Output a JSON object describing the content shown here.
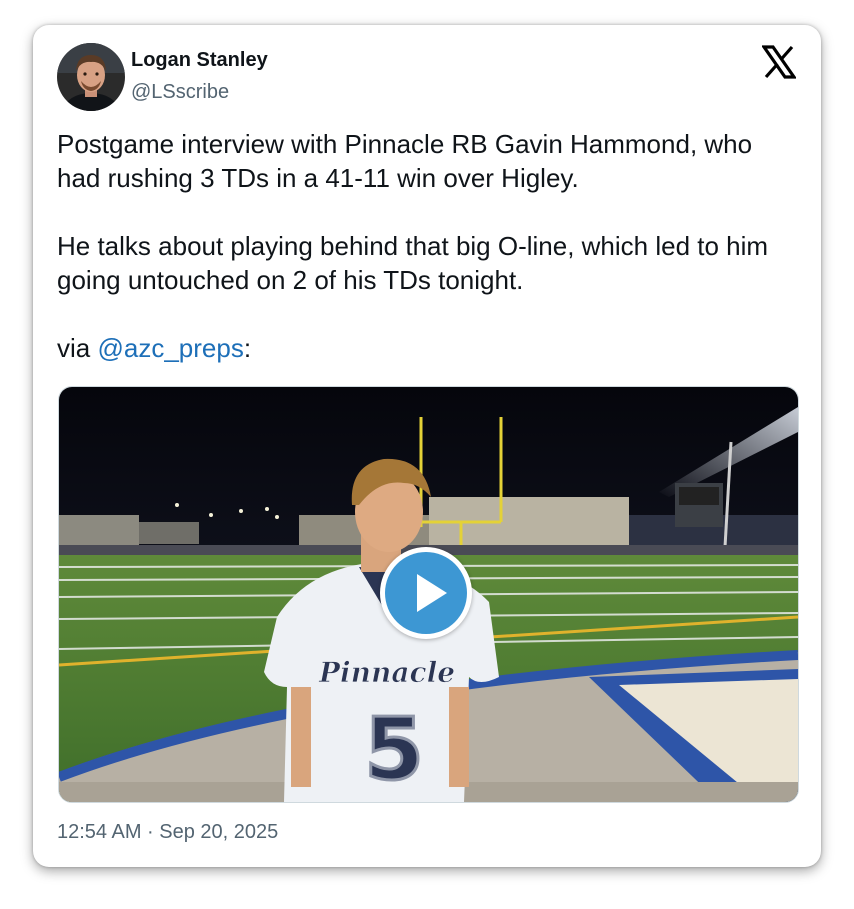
{
  "tweet": {
    "author_name": "Logan Stanley",
    "author_handle": "@LSscribe",
    "platform_icon": "x-logo-icon",
    "paragraphs": [
      "Postgame interview with Pinnacle RB Gavin Hammond, who had rushing 3 TDs in a 41-11 win over Higley.",
      "He talks about playing behind that big O-line, which led to him going untouched on 2 of his TDs tonight."
    ],
    "via_prefix": "via ",
    "mention": "@azc_preps",
    "via_suffix": ":",
    "timestamp": "12:54 AM · Sep 20, 2025"
  },
  "media": {
    "type": "video",
    "jersey_team": "Pinnacle",
    "jersey_number": "5",
    "play_icon": "play-icon"
  },
  "colors": {
    "text": "#0f1419",
    "secondary": "#536471",
    "link": "#1d6fb8",
    "play": "#3d97d3"
  }
}
